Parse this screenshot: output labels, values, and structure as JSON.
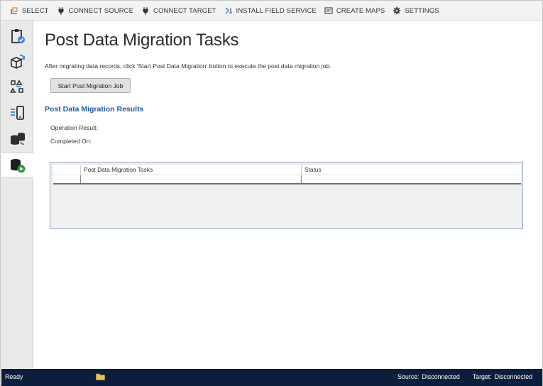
{
  "toolbar": {
    "items": [
      {
        "label": "SELECT",
        "icon": "select-icon"
      },
      {
        "label": "CONNECT SOURCE",
        "icon": "plug-icon"
      },
      {
        "label": "CONNECT TARGET",
        "icon": "plug-icon"
      },
      {
        "label": "INSTALL FIELD SERVICE",
        "icon": "install-icon"
      },
      {
        "label": "CREATE MAPS",
        "icon": "maps-icon"
      },
      {
        "label": "SETTINGS",
        "icon": "gear-icon"
      }
    ]
  },
  "rail": {
    "items": [
      {
        "icon": "clipboard-check-icon"
      },
      {
        "icon": "package-sync-icon"
      },
      {
        "icon": "hierarchy-map-icon"
      },
      {
        "icon": "mobile-list-icon"
      },
      {
        "icon": "database-sync-icon"
      },
      {
        "icon": "database-play-icon",
        "active": true
      }
    ]
  },
  "main": {
    "title": "Post Data Migration Tasks",
    "description": "After migrating data records, click 'Start Post Data Migration' button to execute the post data migration job.",
    "start_button": "Start Post Migration Job",
    "results_title": "Post Data Migration Results",
    "operation_result_label": "Operation Result:",
    "completed_on_label": "Completed On:",
    "grid": {
      "columns": [
        "",
        "Post Data Migration Tasks",
        "Status"
      ],
      "rows": [
        [
          "",
          "",
          ""
        ]
      ]
    }
  },
  "status_bar": {
    "state": "Ready",
    "source_label": "Source:",
    "source_value": "Disconnected",
    "target_label": "Target:",
    "target_value": "Disconnected"
  },
  "colors": {
    "accent_blue": "#1f5aa8",
    "status_bar_bg": "#0b1f3c",
    "grid_border": "#8fa9c8"
  }
}
